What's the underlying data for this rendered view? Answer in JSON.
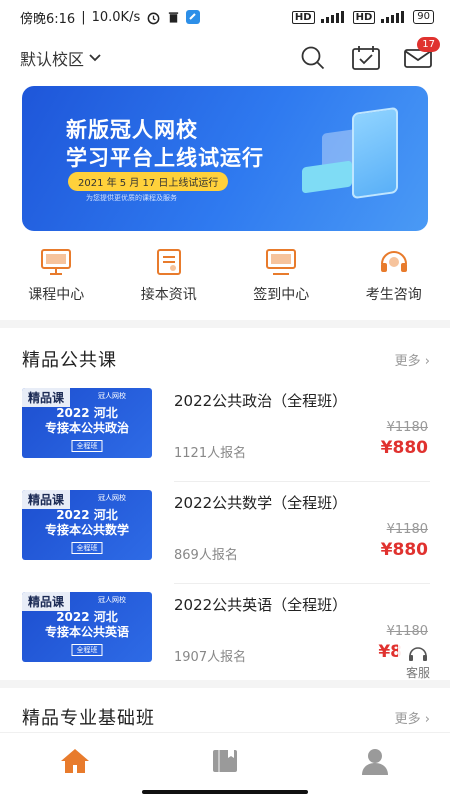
{
  "status_bar": {
    "time": "傍晚6:16",
    "speed": "10.0K/s",
    "net1": "HD",
    "net2": "HD",
    "battery": "90"
  },
  "header": {
    "campus": "默认校区",
    "message_badge": "17"
  },
  "banner": {
    "title_line1": "新版冠人网校",
    "title_line2": "学习平台上线试运行",
    "date_pill": "2021 年 5 月 17 日上线试运行",
    "subtitle": "为您提供更优质的课程及服务"
  },
  "quick_links": [
    {
      "label": "课程中心",
      "icon": "monitor-icon"
    },
    {
      "label": "接本资讯",
      "icon": "news-icon"
    },
    {
      "label": "签到中心",
      "icon": "checkin-icon"
    },
    {
      "label": "考生咨询",
      "icon": "headset-icon"
    }
  ],
  "section_public": {
    "title": "精品公共课",
    "more": "更多"
  },
  "courses": [
    {
      "tag": "精品课",
      "brand": "冠人网校",
      "thumb_line1": "2022 河北",
      "thumb_line2": "专接本公共政治",
      "thumb_tag": "全程班",
      "name": "2022公共政治（全程班）",
      "enrolled": "1121人报名",
      "old_price": "¥1180",
      "price": "¥880"
    },
    {
      "tag": "精品课",
      "brand": "冠人网校",
      "thumb_line1": "2022 河北",
      "thumb_line2": "专接本公共数学",
      "thumb_tag": "全程班",
      "name": "2022公共数学（全程班）",
      "enrolled": "869人报名",
      "old_price": "¥1180",
      "price": "¥880"
    },
    {
      "tag": "精品课",
      "brand": "冠人网校",
      "thumb_line1": "2022 河北",
      "thumb_line2": "专接本公共英语",
      "thumb_tag": "全程班",
      "name": "2022公共英语（全程班）",
      "enrolled": "1907人报名",
      "old_price": "¥1180",
      "price": "¥8"
    }
  ],
  "kefu": {
    "label": "客服"
  },
  "section_basic": {
    "title": "精品专业基础班",
    "more": "更多"
  },
  "tabs": [
    {
      "icon": "home-icon",
      "active": true
    },
    {
      "icon": "book-icon",
      "active": false
    },
    {
      "icon": "user-icon",
      "active": false
    }
  ],
  "colors": {
    "accent": "#e87b2c",
    "price": "#e0322f",
    "banner": "#2566e3"
  }
}
